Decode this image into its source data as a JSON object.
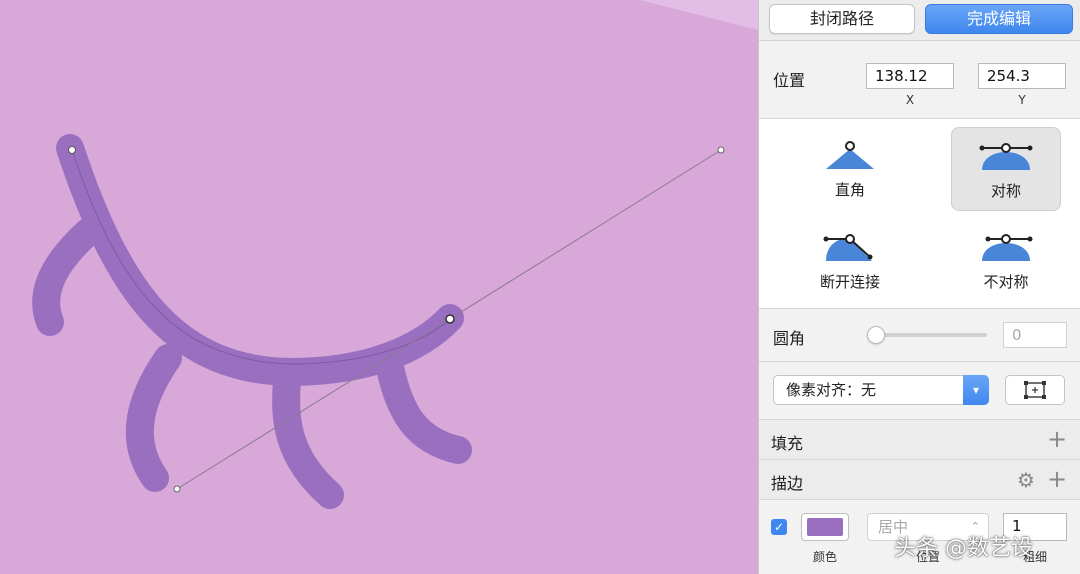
{
  "colors": {
    "canvas_bg": "#d8a8d8",
    "stroke_purple": "#9a6fc0",
    "accent_blue": "#3f86ee",
    "swatch_purple": "#9a6fc0"
  },
  "toolbar": {
    "close_path_label": "封闭路径",
    "finish_edit_label": "完成编辑"
  },
  "position": {
    "label": "位置",
    "x_value": "138.12",
    "y_value": "254.3",
    "x_caption": "X",
    "y_caption": "Y"
  },
  "node_types": [
    {
      "label": "直角",
      "icon": "corner-node-icon"
    },
    {
      "label": "对称",
      "icon": "mirrored-node-icon",
      "selected": true
    },
    {
      "label": "断开连接",
      "icon": "disconnected-node-icon"
    },
    {
      "label": "不对称",
      "icon": "asymmetric-node-icon"
    }
  ],
  "corner_radius": {
    "label": "圆角",
    "value": "0",
    "slider_fraction": 0
  },
  "pixel_align": {
    "selected": "像素对齐：无"
  },
  "fill": {
    "label": "填充"
  },
  "border": {
    "label": "描边",
    "enabled": true,
    "position_value": "居中",
    "thickness_value": "1",
    "color_caption": "颜色",
    "position_caption": "位置",
    "thickness_caption": "粗细"
  },
  "watermark": "头条 @数艺设"
}
